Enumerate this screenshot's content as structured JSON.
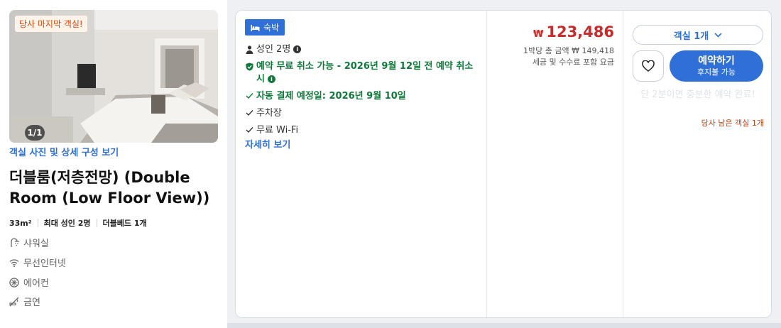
{
  "room": {
    "photo_badge": "당사 마지막 객실!",
    "photo_counter": "1/1",
    "photo_link": "객실 사진 및 상세 구성 보기",
    "title": "더블룸(저층전망) (Double Room (Low Floor View))",
    "specs": [
      "33m²",
      "최대 성인 2명",
      "더블베드 1개"
    ],
    "amenities": [
      {
        "icon": "shower-icon",
        "label": "샤워실"
      },
      {
        "icon": "wifi-icon",
        "label": "무선인터넷"
      },
      {
        "icon": "aircon-icon",
        "label": "에어컨"
      },
      {
        "icon": "no-smoking-icon",
        "label": "금연"
      }
    ]
  },
  "option": {
    "stay_badge": "숙박",
    "guests": "성인 2명",
    "free_cancel": "예약 무료 취소 가능 - 2026년 9월 12일 전 예약 취소 시",
    "auto_pay": "자동 결제 예정일: 2026년 9월 10일",
    "features": [
      "주차장",
      "무료 Wi-Fi"
    ],
    "detail_link": "자세히 보기"
  },
  "price": {
    "currency": "₩",
    "amount": "123,486",
    "total_note": "1박당 총 금액 ₩ 149,418",
    "tax_note": "세금 및 수수료 포함 요금"
  },
  "actions": {
    "room_select": "객실 1개",
    "reserve_label": "예약하기",
    "reserve_sub": "후지불 가능",
    "urgency": "단 2분이면 충분한 예약 완료!",
    "rooms_left": "당사 남은 객실 1개"
  },
  "colors": {
    "accent": "#2f6fd8",
    "price": "#c92a2a",
    "success": "#0f7a3a",
    "warning": "#c2410c"
  }
}
